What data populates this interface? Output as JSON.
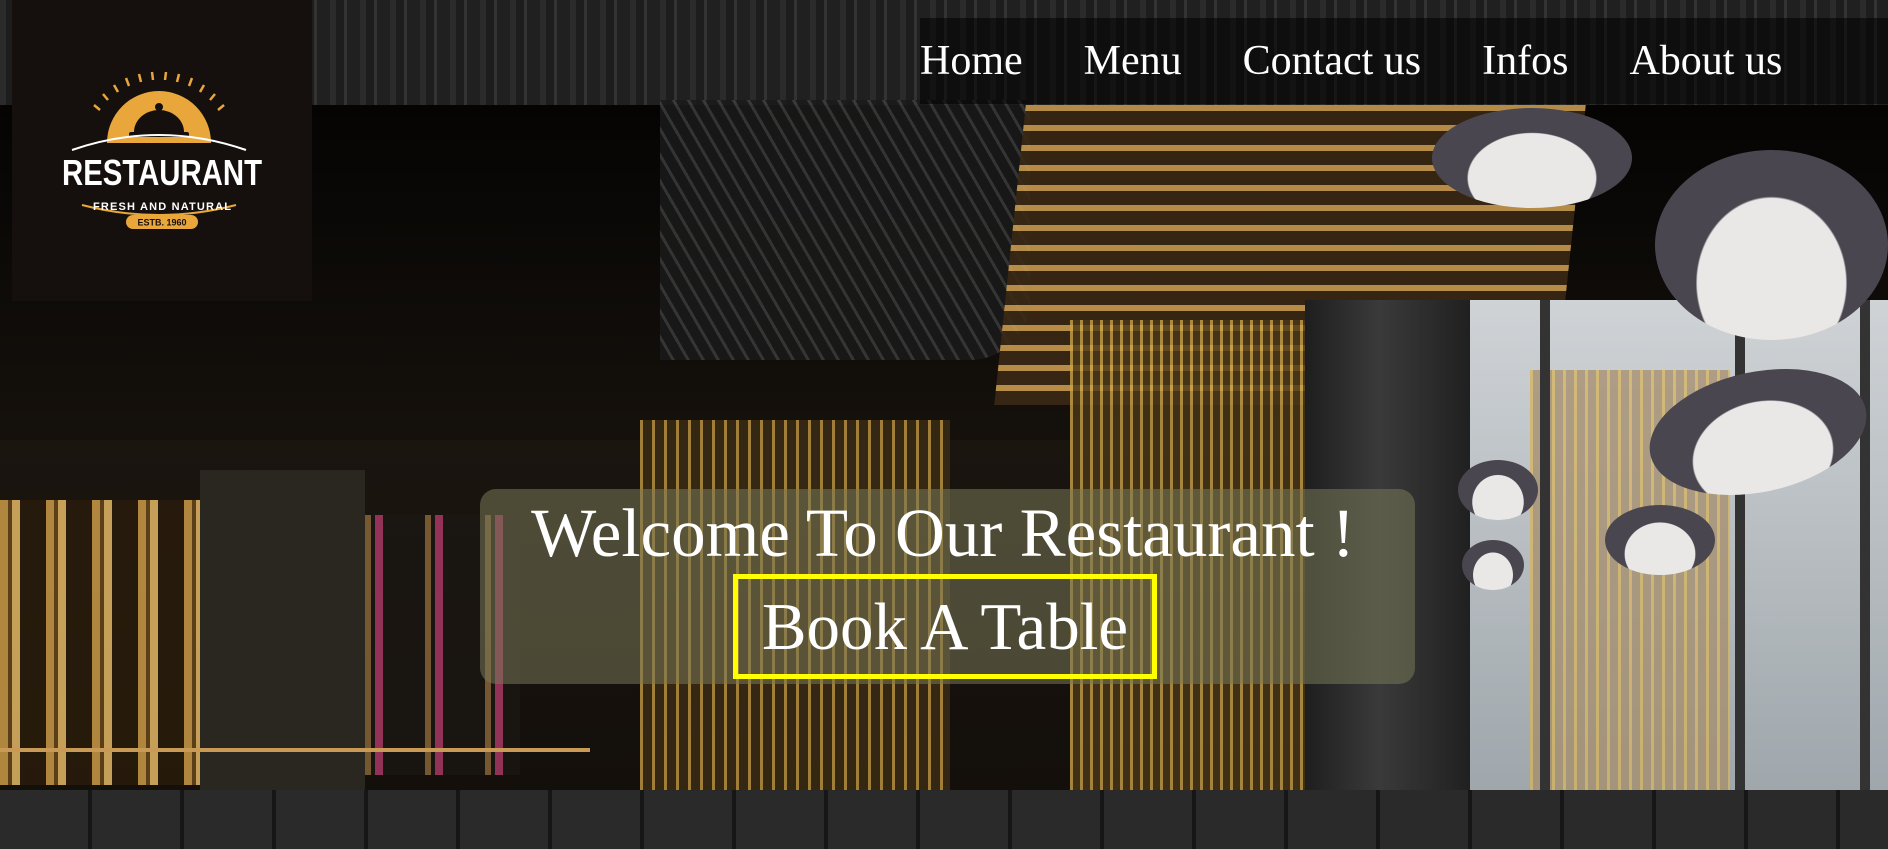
{
  "logo": {
    "brand": "RESTAURANT",
    "tagline": "FRESH AND NATURAL",
    "established": "ESTB. 1960",
    "colors": {
      "background": "#150f0d",
      "gold": "#e9a73b",
      "text": "#ffffff"
    }
  },
  "nav": {
    "items": [
      {
        "label": "Home"
      },
      {
        "label": "Menu"
      },
      {
        "label": "Contact us"
      },
      {
        "label": "Infos"
      },
      {
        "label": "About us"
      }
    ]
  },
  "hero": {
    "title": "Welcome To Our Restaurant !",
    "cta_label": "Book A Table",
    "cta_border_color": "#ffff00"
  }
}
